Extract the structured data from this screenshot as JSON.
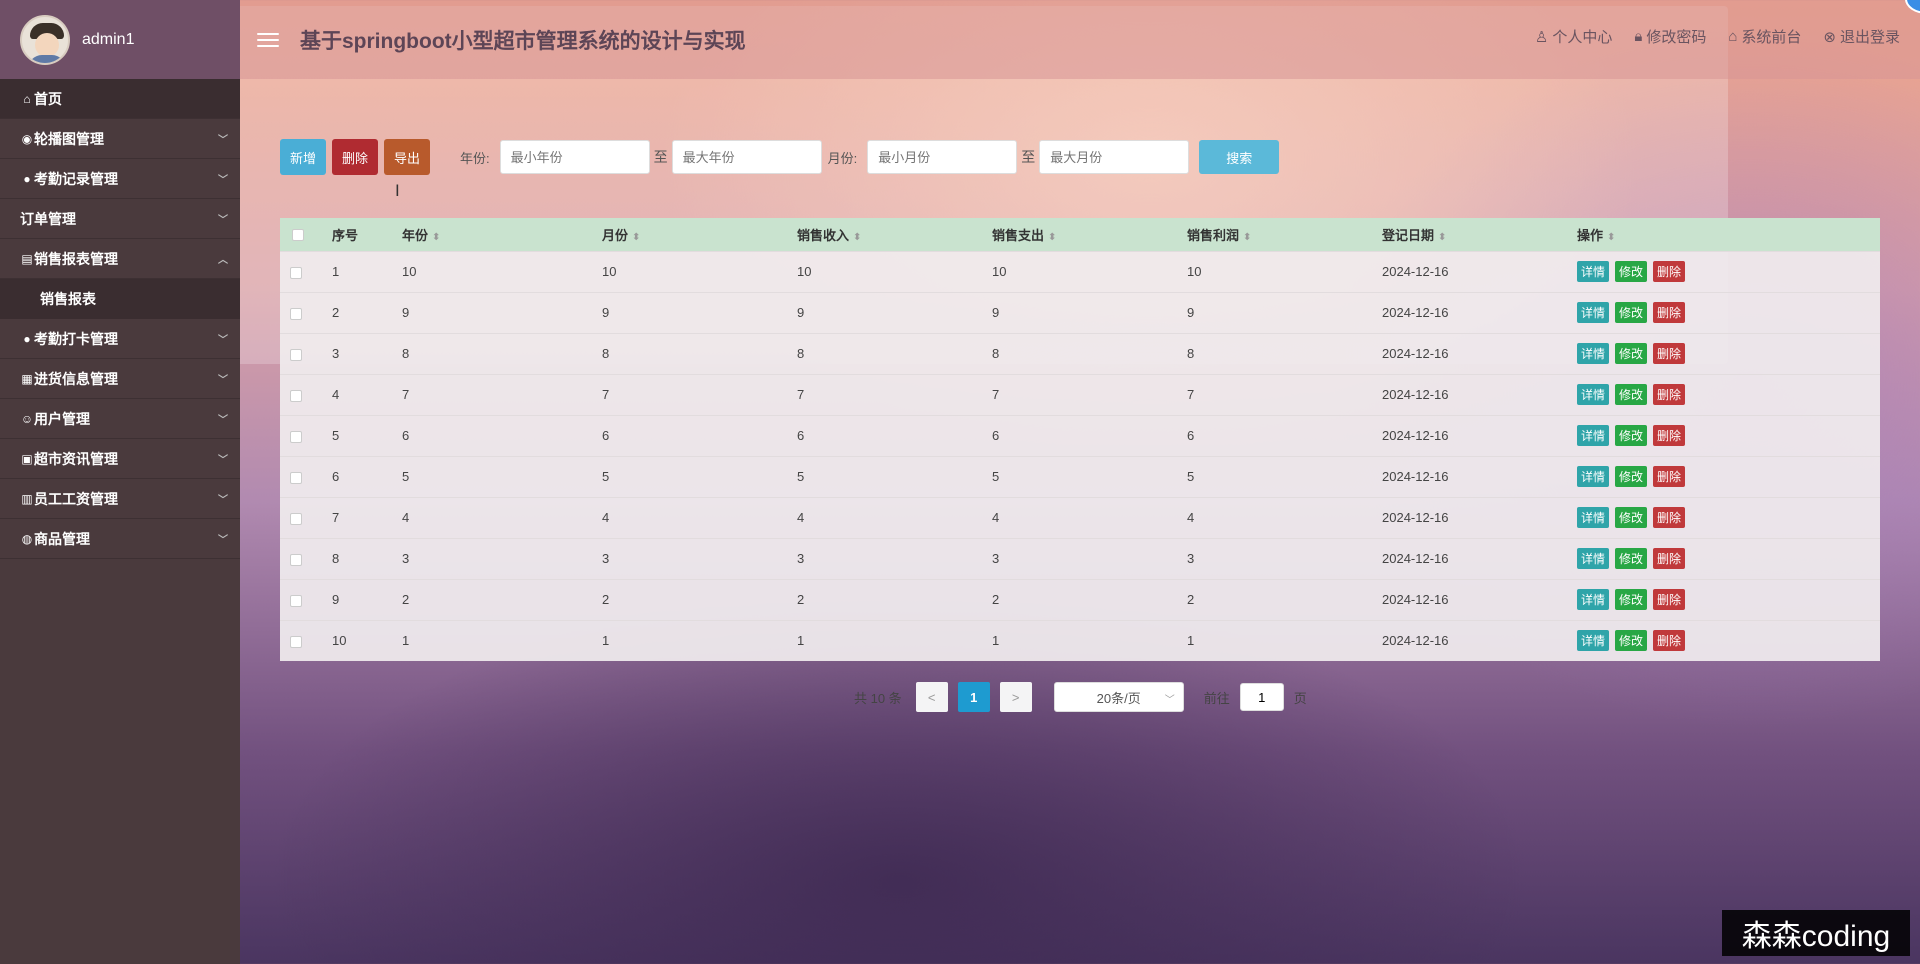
{
  "user": {
    "name": "admin1"
  },
  "header": {
    "title": "基于springboot小型超市管理系统的设计与实现",
    "links": [
      "个人中心",
      "修改密码",
      "系统前台",
      "退出登录"
    ]
  },
  "sidebar": {
    "items": [
      {
        "label": "首页",
        "icon": "home-icon"
      },
      {
        "label": "轮播图管理",
        "icon": "carousel-icon"
      },
      {
        "label": "考勤记录管理",
        "icon": "record-icon"
      },
      {
        "label": "订单管理",
        "icon": ""
      },
      {
        "label": "销售报表管理",
        "icon": "report-icon"
      },
      {
        "label": "销售报表",
        "icon": ""
      },
      {
        "label": "考勤打卡管理",
        "icon": "clock-icon"
      },
      {
        "label": "进货信息管理",
        "icon": "stock-icon"
      },
      {
        "label": "用户管理",
        "icon": "user-icon"
      },
      {
        "label": "超市资讯管理",
        "icon": "news-icon"
      },
      {
        "label": "员工工资管理",
        "icon": "salary-icon"
      },
      {
        "label": "商品管理",
        "icon": "goods-icon"
      }
    ]
  },
  "toolbar": {
    "add": "新增",
    "delete": "删除",
    "export": "导出",
    "year_label": "年份:",
    "month_label": "月份:",
    "to": "至",
    "min_year_ph": "最小年份",
    "max_year_ph": "最大年份",
    "min_month_ph": "最小月份",
    "max_month_ph": "最大月份",
    "search": "搜索"
  },
  "table": {
    "columns": [
      "序号",
      "年份",
      "月份",
      "销售收入",
      "销售支出",
      "销售利润",
      "登记日期",
      "操作"
    ],
    "actions": {
      "detail": "详情",
      "edit": "修改",
      "delete": "删除"
    },
    "rows": [
      [
        "1",
        "10",
        "10",
        "10",
        "10",
        "10",
        "2024-12-16"
      ],
      [
        "2",
        "9",
        "9",
        "9",
        "9",
        "9",
        "2024-12-16"
      ],
      [
        "3",
        "8",
        "8",
        "8",
        "8",
        "8",
        "2024-12-16"
      ],
      [
        "4",
        "7",
        "7",
        "7",
        "7",
        "7",
        "2024-12-16"
      ],
      [
        "5",
        "6",
        "6",
        "6",
        "6",
        "6",
        "2024-12-16"
      ],
      [
        "6",
        "5",
        "5",
        "5",
        "5",
        "5",
        "2024-12-16"
      ],
      [
        "7",
        "4",
        "4",
        "4",
        "4",
        "4",
        "2024-12-16"
      ],
      [
        "8",
        "3",
        "3",
        "3",
        "3",
        "3",
        "2024-12-16"
      ],
      [
        "9",
        "2",
        "2",
        "2",
        "2",
        "2",
        "2024-12-16"
      ],
      [
        "10",
        "1",
        "1",
        "1",
        "1",
        "1",
        "2024-12-16"
      ]
    ]
  },
  "pagination": {
    "total": "共 10 条",
    "prev": "<",
    "current": "1",
    "next": ">",
    "page_size": "20条/页",
    "goto_label": "前往",
    "goto_value": "1",
    "page_suffix": "页"
  },
  "watermark": "森森coding"
}
